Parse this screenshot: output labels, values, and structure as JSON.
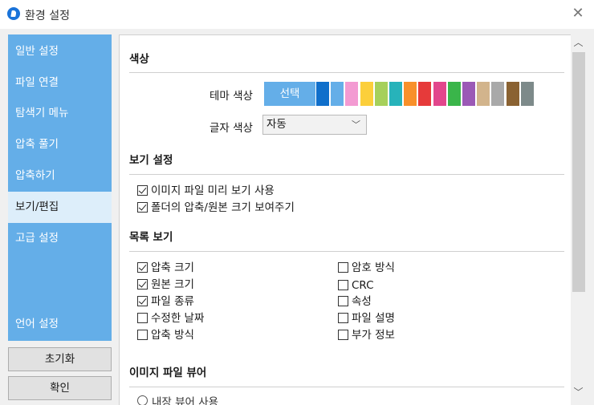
{
  "window": {
    "title": "환경 설정"
  },
  "sidebar": {
    "items": [
      {
        "label": "일반 설정"
      },
      {
        "label": "파일 연결"
      },
      {
        "label": "탐색기 메뉴"
      },
      {
        "label": "압축 풀기"
      },
      {
        "label": "압축하기"
      },
      {
        "label": "보기/편집"
      },
      {
        "label": "고급 설정"
      },
      {
        "label": "언어 설정"
      }
    ],
    "active": "보기/편집"
  },
  "buttons": {
    "reset": "초기화",
    "ok": "확인"
  },
  "color_section": {
    "title": "색상",
    "theme_label": "테마 색상",
    "theme_selected_label": "선택",
    "theme_swatches": [
      "#0f6fcb",
      "#64aee8",
      "#f39ad2",
      "#fccf3b",
      "#a6d05b",
      "#27b3ba",
      "#f8902a",
      "#e63a3a",
      "#e2468c",
      "#3ab54a",
      "#9b59b6",
      "#d2b48c",
      "#a9a9a9",
      "#8a6232",
      "#7d8a8a"
    ],
    "text_color_label": "글자 색상",
    "text_color_value": "자동"
  },
  "view_section": {
    "title": "보기 설정",
    "options": [
      {
        "label": "이미지 파일 미리 보기 사용",
        "checked": true
      },
      {
        "label": "폴더의 압축/원본 크기 보여주기",
        "checked": true
      }
    ]
  },
  "list_section": {
    "title": "목록 보기",
    "left_options": [
      {
        "label": "압축 크기",
        "checked": true
      },
      {
        "label": "원본 크기",
        "checked": true
      },
      {
        "label": "파일 종류",
        "checked": true
      },
      {
        "label": "수정한 날짜",
        "checked": false
      },
      {
        "label": "압축 방식",
        "checked": false
      }
    ],
    "right_options": [
      {
        "label": "암호 방식",
        "checked": false
      },
      {
        "label": "CRC",
        "checked": false
      },
      {
        "label": "속성",
        "checked": false
      },
      {
        "label": "파일 설명",
        "checked": false
      },
      {
        "label": "부가 정보",
        "checked": false
      }
    ]
  },
  "image_viewer_section": {
    "title": "이미지 파일 뷰어",
    "partial_option": "내장 뷰어 사용"
  }
}
